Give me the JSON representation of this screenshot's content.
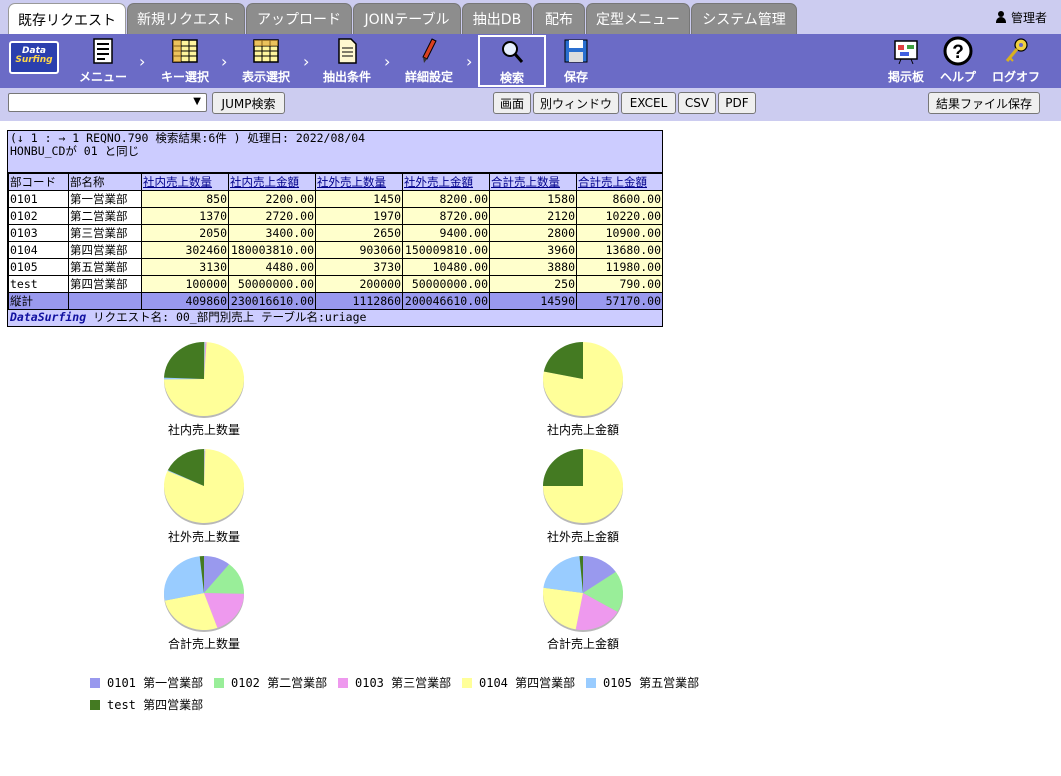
{
  "tabs": [
    {
      "label": "既存リクエスト",
      "active": true
    },
    {
      "label": "新規リクエスト",
      "active": false
    },
    {
      "label": "アップロード",
      "active": false
    },
    {
      "label": "JOINテーブル",
      "active": false
    },
    {
      "label": "抽出DB",
      "active": false
    },
    {
      "label": "配布",
      "active": false
    },
    {
      "label": "定型メニュー",
      "active": false
    },
    {
      "label": "システム管理",
      "active": false
    }
  ],
  "user": {
    "name": "管理者",
    "icon": "user-icon"
  },
  "logo": {
    "line1": "Data",
    "line2": "Surfing"
  },
  "toolbar": {
    "menu": "メニュー",
    "key_select": "キー選択",
    "display_select": "表示選択",
    "extract_cond": "抽出条件",
    "detail": "詳細設定",
    "search": "検索",
    "save": "保存",
    "board": "掲示板",
    "help": "ヘルプ",
    "logoff": "ログオフ"
  },
  "subbar": {
    "jump_select_value": "",
    "jump_button": "JUMP検索",
    "screen": "画面",
    "new_window": "別ウィンドウ",
    "excel": "EXCEL",
    "csv": "CSV",
    "pdf": "PDF",
    "save_result": "結果ファイル保存"
  },
  "result": {
    "header_line1": "(↓ 1 : → 1 REQNO.790 検索結果:6件 ) 処理日: 2022/08/04",
    "header_line2": "HONBU_CDが 01 と同じ",
    "columns": [
      "部コード",
      "部名称",
      "社内売上数量",
      "社内売上金額",
      "社外売上数量",
      "社外売上金額",
      "合計売上数量",
      "合計売上金額"
    ],
    "rows": [
      [
        "0101",
        "第一営業部",
        "850",
        "2200.00",
        "1450",
        "8200.00",
        "1580",
        "8600.00"
      ],
      [
        "0102",
        "第二営業部",
        "1370",
        "2720.00",
        "1970",
        "8720.00",
        "2120",
        "10220.00"
      ],
      [
        "0103",
        "第三営業部",
        "2050",
        "3400.00",
        "2650",
        "9400.00",
        "2800",
        "10900.00"
      ],
      [
        "0104",
        "第四営業部",
        "302460",
        "180003810.00",
        "903060",
        "150009810.00",
        "3960",
        "13680.00"
      ],
      [
        "0105",
        "第五営業部",
        "3130",
        "4480.00",
        "3730",
        "10480.00",
        "3880",
        "11980.00"
      ],
      [
        "test",
        "第四営業部",
        "100000",
        "50000000.00",
        "200000",
        "50000000.00",
        "250",
        "790.00"
      ]
    ],
    "total": [
      "縦計",
      "",
      "409860",
      "230016610.00",
      "1112860",
      "200046610.00",
      "14590",
      "57170.00"
    ],
    "footer_brand": "DataSurfing",
    "footer_text": "リクエスト名: 00_部門別売上 テーブル名:uriage"
  },
  "chart_data": [
    {
      "type": "pie",
      "title": "社内売上数量",
      "categories": [
        "0101 第一営業部",
        "0102 第二営業部",
        "0103 第三営業部",
        "0104 第四営業部",
        "0105 第五営業部",
        "test 第四営業部"
      ],
      "values": [
        850,
        1370,
        2050,
        302460,
        3130,
        100000
      ]
    },
    {
      "type": "pie",
      "title": "社内売上金額",
      "categories": [
        "0101 第一営業部",
        "0102 第二営業部",
        "0103 第三営業部",
        "0104 第四営業部",
        "0105 第五営業部",
        "test 第四営業部"
      ],
      "values": [
        2200,
        2720,
        3400,
        180003810,
        4480,
        50000000
      ]
    },
    {
      "type": "pie",
      "title": "社外売上数量",
      "categories": [
        "0101 第一営業部",
        "0102 第二営業部",
        "0103 第三営業部",
        "0104 第四営業部",
        "0105 第五営業部",
        "test 第四営業部"
      ],
      "values": [
        1450,
        1970,
        2650,
        903060,
        3730,
        200000
      ]
    },
    {
      "type": "pie",
      "title": "社外売上金額",
      "categories": [
        "0101 第一営業部",
        "0102 第二営業部",
        "0103 第三営業部",
        "0104 第四営業部",
        "0105 第五営業部",
        "test 第四営業部"
      ],
      "values": [
        8200,
        8720,
        9400,
        150009810,
        10480,
        50000000
      ]
    },
    {
      "type": "pie",
      "title": "合計売上数量",
      "categories": [
        "0101 第一営業部",
        "0102 第二営業部",
        "0103 第三営業部",
        "0104 第四営業部",
        "0105 第五営業部",
        "test 第四営業部"
      ],
      "values": [
        1580,
        2120,
        2800,
        3960,
        3880,
        250
      ]
    },
    {
      "type": "pie",
      "title": "合計売上金額",
      "categories": [
        "0101 第一営業部",
        "0102 第二営業部",
        "0103 第三営業部",
        "0104 第四営業部",
        "0105 第五営業部",
        "test 第四営業部"
      ],
      "values": [
        8600,
        10220,
        10900,
        13680,
        11980,
        790
      ]
    }
  ],
  "legend": [
    {
      "label": "0101 第一営業部",
      "color": "#9999ee"
    },
    {
      "label": "0102 第二営業部",
      "color": "#99ee99"
    },
    {
      "label": "0103 第三営業部",
      "color": "#ee99ee"
    },
    {
      "label": "0104 第四営業部",
      "color": "#ffff99"
    },
    {
      "label": "0105 第五営業部",
      "color": "#99ccff"
    },
    {
      "label": "test 第四営業部",
      "color": "#447a22"
    }
  ]
}
